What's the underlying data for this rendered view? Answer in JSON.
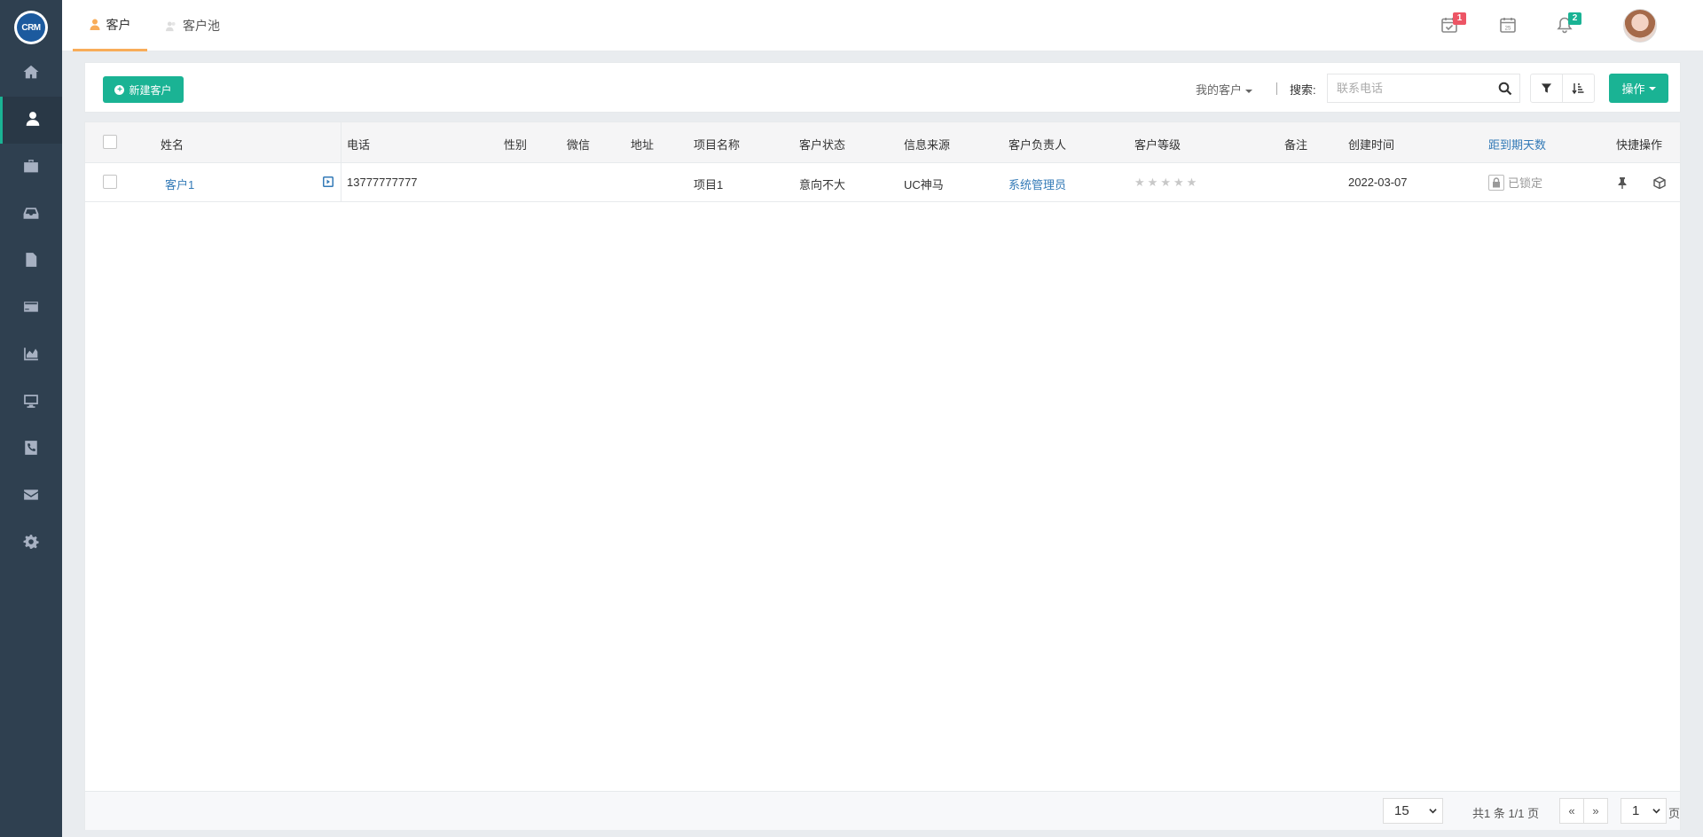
{
  "logo": {
    "text": "CRM"
  },
  "sidebar": {
    "items": [
      {
        "icon": "home-icon"
      },
      {
        "icon": "user-icon",
        "active": true
      },
      {
        "icon": "briefcase-icon"
      },
      {
        "icon": "inbox-icon"
      },
      {
        "icon": "file-icon"
      },
      {
        "icon": "credit-card-icon"
      },
      {
        "icon": "area-chart-icon"
      },
      {
        "icon": "desktop-icon"
      },
      {
        "icon": "phone-icon"
      },
      {
        "icon": "envelope-icon"
      },
      {
        "icon": "gear-icon"
      }
    ]
  },
  "header": {
    "tabs": [
      {
        "label": "客户",
        "active": true
      },
      {
        "label": "客户池",
        "active": false
      }
    ],
    "icons": {
      "tasks_badge": "1",
      "notifications_badge": "2"
    },
    "colors": {
      "tasks_badge": "#ed5565",
      "notifications_badge": "#1ab394",
      "accent_tab": "#f8ac59"
    }
  },
  "toolbar": {
    "new_button": "新建客户",
    "scope": "我的客户",
    "search_label": "搜索:",
    "search_placeholder": "联系电话",
    "search_value": "",
    "operate_button": "操作",
    "primary_color": "#1ab394"
  },
  "table": {
    "columns": [
      "姓名",
      "电话",
      "性别",
      "微信",
      "地址",
      "项目名称",
      "客户状态",
      "信息来源",
      "客户负责人",
      "客户等级",
      "备注",
      "创建时间",
      "距到期天数",
      "快捷操作"
    ],
    "rows": [
      {
        "name": "客户1",
        "phone": "13777777777",
        "gender": "",
        "wechat": "",
        "address": "",
        "project": "项目1",
        "status": "意向不大",
        "source": "UC神马",
        "owner": "系统管理员",
        "rating": 0,
        "rating_max": 5,
        "note": "",
        "created": "2022-03-07",
        "expiry": "已锁定"
      }
    ]
  },
  "pagination": {
    "page_size": "15",
    "info": "共1 条 1/1 页",
    "prev": "«",
    "next": "»",
    "current_page": "1",
    "unit": "页"
  }
}
